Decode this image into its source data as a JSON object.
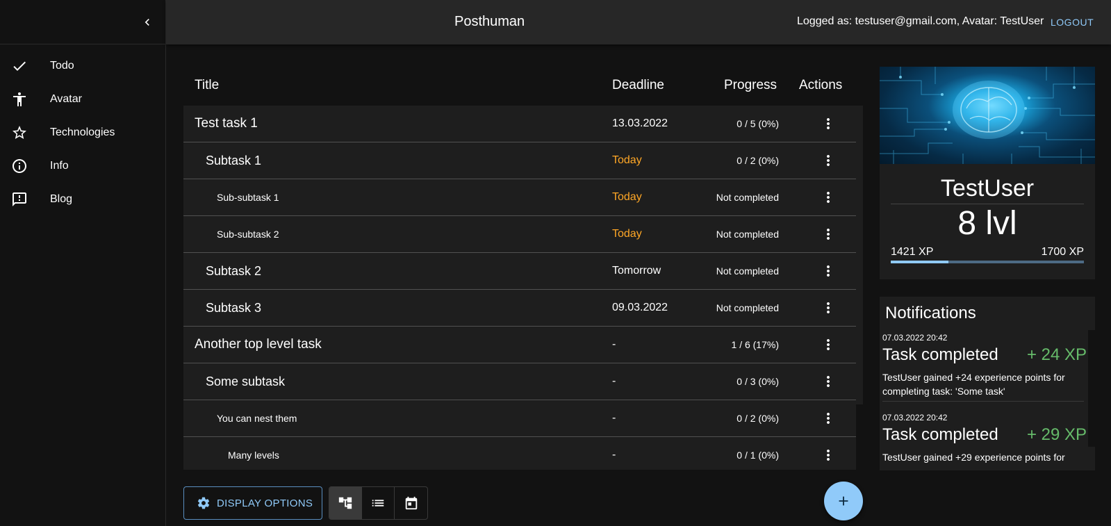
{
  "sidebar": {
    "items": [
      {
        "label": "Todo",
        "icon": "check-icon"
      },
      {
        "label": "Avatar",
        "icon": "accessibility-icon"
      },
      {
        "label": "Technologies",
        "icon": "star-outline-icon"
      },
      {
        "label": "Info",
        "icon": "info-icon"
      },
      {
        "label": "Blog",
        "icon": "feedback-icon"
      }
    ]
  },
  "header": {
    "title": "Posthuman",
    "logged_as": "Logged as: testuser@gmail.com,  Avatar: TestUser",
    "logout_label": "LOGOUT"
  },
  "table": {
    "columns": {
      "title": "Title",
      "deadline": "Deadline",
      "progress": "Progress",
      "actions": "Actions"
    },
    "rows": [
      {
        "title": "Test task 1",
        "level": 0,
        "deadline": "13.03.2022",
        "deadline_status": "normal",
        "progress": "0 / 5 (0%)"
      },
      {
        "title": "Subtask 1",
        "level": 1,
        "deadline": "Today",
        "deadline_status": "today",
        "progress": "0 / 2 (0%)"
      },
      {
        "title": "Sub-subtask 1",
        "level": 2,
        "deadline": "Today",
        "deadline_status": "today",
        "progress": "Not completed"
      },
      {
        "title": "Sub-subtask 2",
        "level": 2,
        "deadline": "Today",
        "deadline_status": "today",
        "progress": "Not completed"
      },
      {
        "title": "Subtask 2",
        "level": 1,
        "deadline": "Tomorrow",
        "deadline_status": "normal",
        "progress": "Not completed"
      },
      {
        "title": "Subtask 3",
        "level": 1,
        "deadline": "09.03.2022",
        "deadline_status": "normal",
        "progress": "Not completed"
      },
      {
        "title": "Another top level task",
        "level": 0,
        "deadline": "-",
        "deadline_status": "normal",
        "progress": "1 / 6 (17%)"
      },
      {
        "title": "Some subtask",
        "level": 1,
        "deadline": "-",
        "deadline_status": "normal",
        "progress": "0 / 3 (0%)"
      },
      {
        "title": "You can nest them",
        "level": 2,
        "deadline": "-",
        "deadline_status": "normal",
        "progress": "0 / 2 (0%)"
      },
      {
        "title": "Many levels",
        "level": 3,
        "deadline": "-",
        "deadline_status": "normal",
        "progress": "0 / 1 (0%)"
      }
    ]
  },
  "controls": {
    "display_options_label": "DISPLAY OPTIONS",
    "views": [
      {
        "name": "tree-view",
        "icon": "account-tree-icon",
        "active": true
      },
      {
        "name": "list-view",
        "icon": "list-icon",
        "active": false
      },
      {
        "name": "calendar-view",
        "icon": "calendar-icon",
        "active": false
      }
    ],
    "fab_icon": "plus-icon"
  },
  "avatar": {
    "name": "TestUser",
    "level": "8 lvl",
    "xp_current": "1421 XP",
    "xp_next": "1700 XP",
    "xp_progress": 0.3
  },
  "notifications": {
    "title": "Notifications",
    "items": [
      {
        "date": "07.03.2022 20:42",
        "title": "Task completed",
        "xp": "+ 24 XP",
        "text": "TestUser gained +24 experience points for completing task: 'Some task'"
      },
      {
        "date": "07.03.2022 20:42",
        "title": "Task completed",
        "xp": "+ 29 XP",
        "text": "TestUser gained +29 experience points for"
      }
    ]
  },
  "colors": {
    "accent": "#90caf9",
    "today": "#ffa726",
    "xp_gain": "#66bb6a"
  }
}
